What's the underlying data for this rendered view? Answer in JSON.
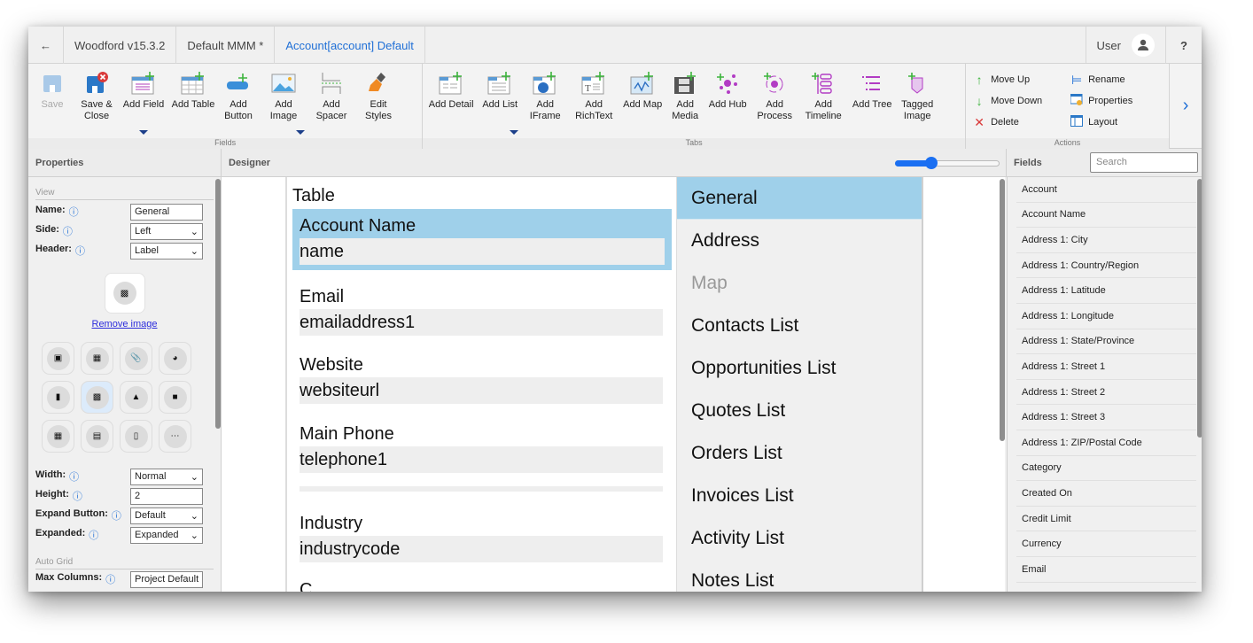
{
  "titlebar": {
    "tabs": [
      "Woodford v15.3.2",
      "Default MMM *",
      "Account[account] Default"
    ],
    "user_label": "User",
    "help": "?"
  },
  "ribbon": {
    "fields_group": {
      "label": "Fields",
      "buttons": [
        "Save",
        "Save & Close",
        "Add Field",
        "Add Table",
        "Add Button",
        "Add Image",
        "Add Spacer",
        "Edit Styles"
      ]
    },
    "tabs_group": {
      "label": "Tabs",
      "buttons": [
        "Add Detail",
        "Add List",
        "Add IFrame",
        "Add RichText",
        "Add Map",
        "Add Media",
        "Add Hub",
        "Add Process",
        "Add Timeline",
        "Add Tree",
        "Tagged Image"
      ]
    },
    "actions_group": {
      "label": "Actions",
      "items": [
        "Move Up",
        "Rename",
        "Move Down",
        "Properties",
        "Delete",
        "Layout"
      ]
    },
    "colors": {
      "accent": "#1f6fd6",
      "green": "#3cb43c",
      "red": "#d93a3a",
      "purple": "#b23cc4"
    }
  },
  "properties": {
    "header": "Properties",
    "view_section": "View",
    "name_label": "Name:",
    "name_value": "General",
    "side_label": "Side:",
    "side_value": "Left",
    "header_label": "Header:",
    "header_value": "Label",
    "remove_image": "Remove image",
    "width_label": "Width:",
    "width_value": "Normal",
    "height_label": "Height:",
    "height_value": "2",
    "expand_button_label": "Expand Button:",
    "expand_button_value": "Default",
    "expanded_label": "Expanded:",
    "expanded_value": "Expanded",
    "auto_grid_section": "Auto Grid",
    "max_columns_label": "Max Columns:",
    "max_columns_value": "Project Default"
  },
  "designer": {
    "header": "Designer",
    "zoom_level": 0.35,
    "form_title": "Table",
    "fields": [
      {
        "label": "Account Name",
        "value": "name",
        "selected": true
      },
      {
        "label": "Email",
        "value": "emailaddress1"
      },
      {
        "label": "Website",
        "value": "websiteurl"
      },
      {
        "label": "Main Phone",
        "value": "telephone1"
      },
      {
        "label": "",
        "value": ""
      },
      {
        "label": "Industry",
        "value": "industrycode"
      },
      {
        "label": "C",
        "value": ""
      }
    ],
    "tabs": [
      {
        "label": "General",
        "selected": true
      },
      {
        "label": "Address"
      },
      {
        "label": "Map",
        "dim": true
      },
      {
        "label": "Contacts List"
      },
      {
        "label": "Opportunities List"
      },
      {
        "label": "Quotes List"
      },
      {
        "label": "Orders List"
      },
      {
        "label": "Invoices List"
      },
      {
        "label": "Activity List"
      },
      {
        "label": "Notes List"
      }
    ],
    "selection_color": "#9fd0ea"
  },
  "fields_panel": {
    "header": "Fields",
    "search_placeholder": "Search",
    "items": [
      "Account",
      "Account Name",
      "Address 1: City",
      "Address 1: Country/Region",
      "Address 1: Latitude",
      "Address 1: Longitude",
      "Address 1: State/Province",
      "Address 1: Street 1",
      "Address 1: Street 2",
      "Address 1: Street 3",
      "Address 1: ZIP/Postal Code",
      "Category",
      "Created On",
      "Credit Limit",
      "Currency",
      "Email"
    ]
  }
}
